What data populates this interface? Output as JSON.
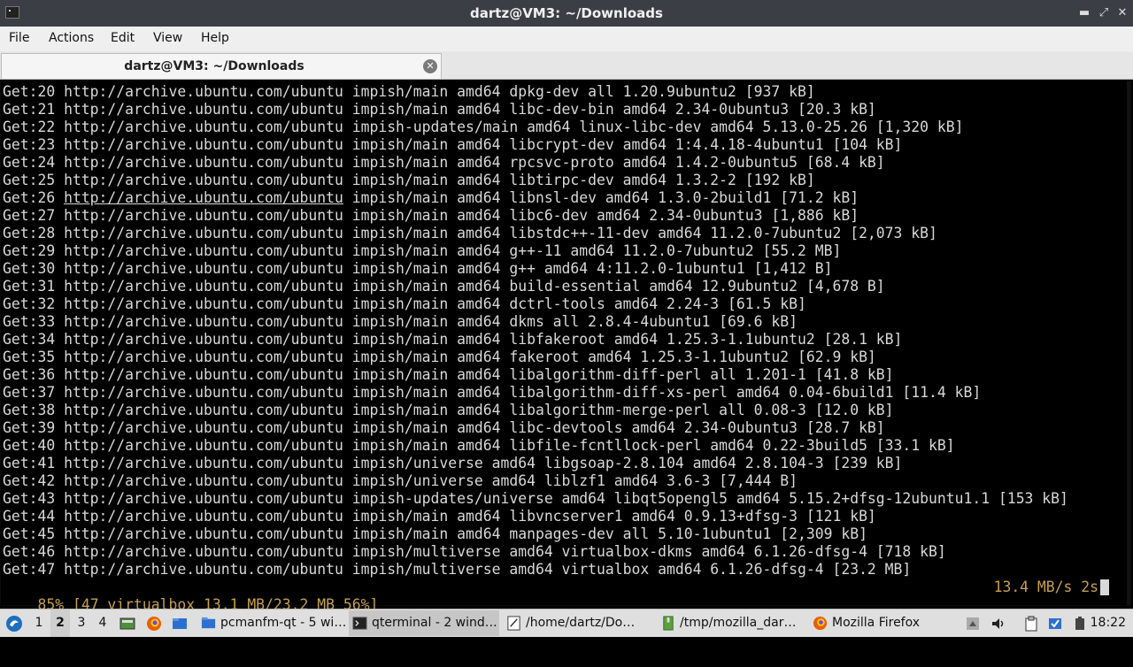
{
  "window": {
    "title": "dartz@VM3: ~/Downloads",
    "controls": [
      "minimize",
      "maximize",
      "close"
    ]
  },
  "menu": [
    "File",
    "Actions",
    "Edit",
    "View",
    "Help"
  ],
  "tab": {
    "label": "dartz@VM3: ~/Downloads"
  },
  "terminal": {
    "lines": [
      "Get:20 http://archive.ubuntu.com/ubuntu impish/main amd64 dpkg-dev all 1.20.9ubuntu2 [937 kB]",
      "Get:21 http://archive.ubuntu.com/ubuntu impish/main amd64 libc-dev-bin amd64 2.34-0ubuntu3 [20.3 kB]",
      "Get:22 http://archive.ubuntu.com/ubuntu impish-updates/main amd64 linux-libc-dev amd64 5.13.0-25.26 [1,320 kB]",
      "Get:23 http://archive.ubuntu.com/ubuntu impish/main amd64 libcrypt-dev amd64 1:4.4.18-4ubuntu1 [104 kB]",
      "Get:24 http://archive.ubuntu.com/ubuntu impish/main amd64 rpcsvc-proto amd64 1.4.2-0ubuntu5 [68.4 kB]",
      "Get:25 http://archive.ubuntu.com/ubuntu impish/main amd64 libtirpc-dev amd64 1.3.2-2 [192 kB]",
      "Get:26 http://archive.ubuntu.com/ubuntu impish/main amd64 libnsl-dev amd64 1.3.0-2build1 [71.2 kB]",
      "Get:27 http://archive.ubuntu.com/ubuntu impish/main amd64 libc6-dev amd64 2.34-0ubuntu3 [1,886 kB]",
      "Get:28 http://archive.ubuntu.com/ubuntu impish/main amd64 libstdc++-11-dev amd64 11.2.0-7ubuntu2 [2,073 kB]",
      "Get:29 http://archive.ubuntu.com/ubuntu impish/main amd64 g++-11 amd64 11.2.0-7ubuntu2 [55.2 MB]",
      "Get:30 http://archive.ubuntu.com/ubuntu impish/main amd64 g++ amd64 4:11.2.0-1ubuntu1 [1,412 B]",
      "Get:31 http://archive.ubuntu.com/ubuntu impish/main amd64 build-essential amd64 12.9ubuntu2 [4,678 B]",
      "Get:32 http://archive.ubuntu.com/ubuntu impish/main amd64 dctrl-tools amd64 2.24-3 [61.5 kB]",
      "Get:33 http://archive.ubuntu.com/ubuntu impish/main amd64 dkms all 2.8.4-4ubuntu1 [69.6 kB]",
      "Get:34 http://archive.ubuntu.com/ubuntu impish/main amd64 libfakeroot amd64 1.25.3-1.1ubuntu2 [28.1 kB]",
      "Get:35 http://archive.ubuntu.com/ubuntu impish/main amd64 fakeroot amd64 1.25.3-1.1ubuntu2 [62.9 kB]",
      "Get:36 http://archive.ubuntu.com/ubuntu impish/main amd64 libalgorithm-diff-perl all 1.201-1 [41.8 kB]",
      "Get:37 http://archive.ubuntu.com/ubuntu impish/main amd64 libalgorithm-diff-xs-perl amd64 0.04-6build1 [11.4 kB]",
      "Get:38 http://archive.ubuntu.com/ubuntu impish/main amd64 libalgorithm-merge-perl all 0.08-3 [12.0 kB]",
      "Get:39 http://archive.ubuntu.com/ubuntu impish/main amd64 libc-devtools amd64 2.34-0ubuntu3 [28.7 kB]",
      "Get:40 http://archive.ubuntu.com/ubuntu impish/main amd64 libfile-fcntllock-perl amd64 0.22-3build5 [33.1 kB]",
      "Get:41 http://archive.ubuntu.com/ubuntu impish/universe amd64 libgsoap-2.8.104 amd64 2.8.104-3 [239 kB]",
      "Get:42 http://archive.ubuntu.com/ubuntu impish/universe amd64 liblzf1 amd64 3.6-3 [7,444 B]",
      "Get:43 http://archive.ubuntu.com/ubuntu impish-updates/universe amd64 libqt5opengl5 amd64 5.15.2+dfsg-12ubuntu1.1 [153 kB]",
      "Get:44 http://archive.ubuntu.com/ubuntu impish/main amd64 libvncserver1 amd64 0.9.13+dfsg-3 [121 kB]",
      "Get:45 http://archive.ubuntu.com/ubuntu impish/main amd64 manpages-dev all 5.10-1ubuntu1 [2,309 kB]",
      "Get:46 http://archive.ubuntu.com/ubuntu impish/multiverse amd64 virtualbox-dkms amd64 6.1.26-dfsg-4 [718 kB]",
      "Get:47 http://archive.ubuntu.com/ubuntu impish/multiverse amd64 virtualbox amd64 6.1.26-dfsg-4 [23.2 MB]"
    ],
    "hovered_link_line": 6,
    "status_left": "85% [47 virtualbox 13.1 MB/23.2 MB 56%]",
    "status_right": "13.4 MB/s 2s"
  },
  "taskbar": {
    "workspaces": [
      "1",
      "2",
      "3",
      "4"
    ],
    "active_workspace": "2",
    "tasks": [
      {
        "label": "pcmanfm-qt - 5 wi…",
        "icon": "folder-icon",
        "active": false
      },
      {
        "label": "qterminal - 2 wind…",
        "icon": "terminal-icon",
        "active": true
      },
      {
        "label": "/home/dartz/Do…",
        "icon": "text-editor-icon",
        "active": false
      },
      {
        "label": "/tmp/mozilla_dar…",
        "icon": "archive-icon",
        "active": false
      },
      {
        "label": "Mozilla Firefox",
        "icon": "firefox-icon",
        "active": false
      }
    ],
    "clock": "18:22"
  },
  "colors": {
    "titlebar_bg": "#3b3f45",
    "terminal_bg": "#000000",
    "terminal_fg": "#d8d8d8",
    "status_fg": "#c6a04e",
    "panel_bg": "#dfdfdf"
  }
}
